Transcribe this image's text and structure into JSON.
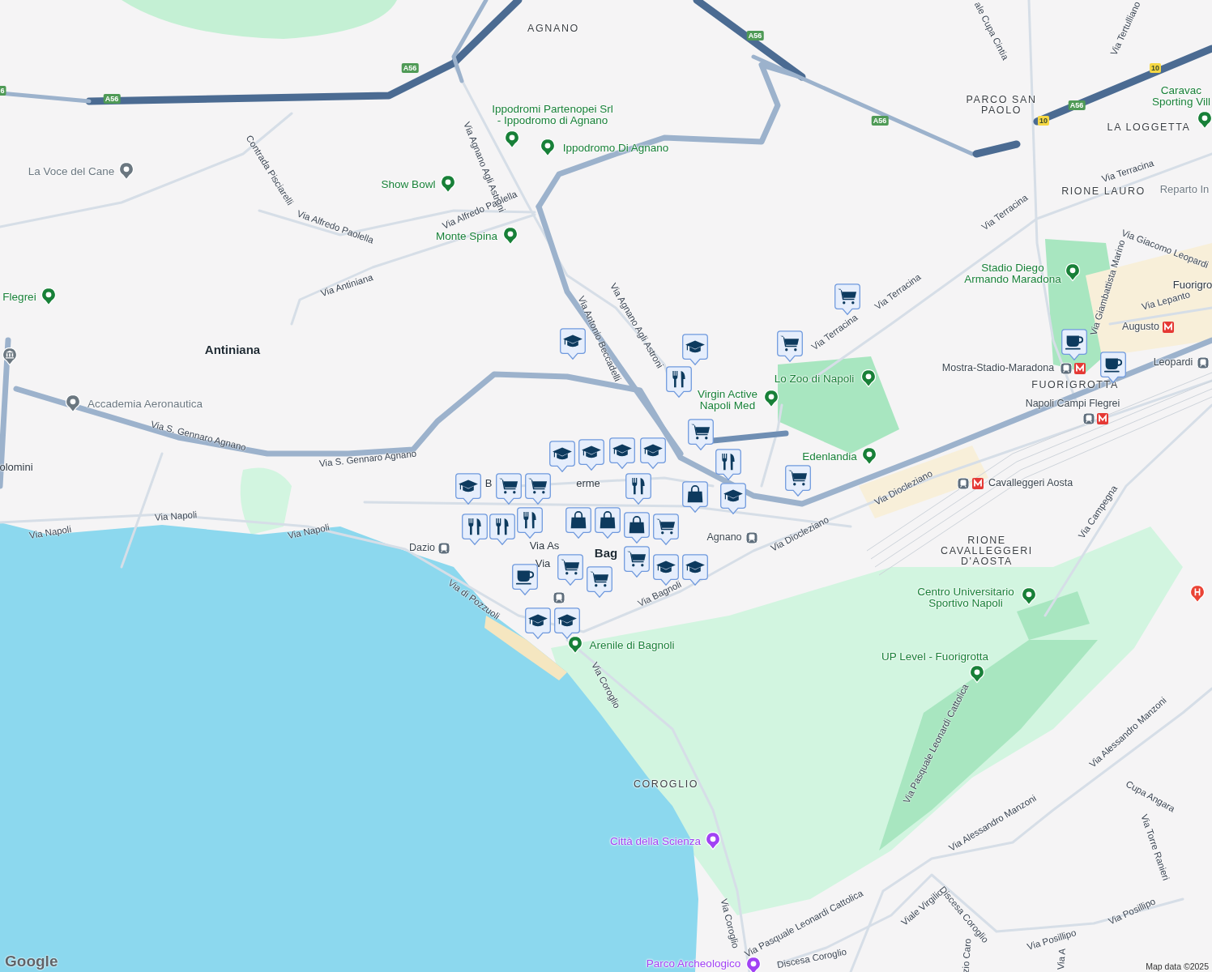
{
  "map": {
    "areas": [
      "AGNANO",
      "PARCO SAN\nPAOLO",
      "LA LOGGETTA",
      "RIONE LAURO",
      "FUORIGROTTA",
      "RIONE\nCAVALLEGGERI\nD'AOSTA",
      "COROGLIO"
    ],
    "labels": [
      {
        "text": "Antiniana",
        "kind": "locality"
      },
      {
        "text": "Fuorigro",
        "kind": "plain"
      },
      {
        "text": "Reparto In",
        "kind": "faded"
      },
      {
        "text": "olomini",
        "kind": "plain"
      },
      {
        "text": "B",
        "kind": "plain"
      },
      {
        "text": "erme",
        "kind": "plain"
      },
      {
        "text": "Via As",
        "kind": "plain"
      },
      {
        "text": "Via",
        "kind": "plain"
      },
      {
        "text": "Bag",
        "kind": "locality"
      }
    ],
    "places": [
      {
        "name": "Ippodromi Partenopei Srl\n- Ippodromo di Agnano",
        "color": "#188038"
      },
      {
        "name": "Ippodromo Di Agnano",
        "color": "#188038"
      },
      {
        "name": "Show Bowl",
        "color": "#188038"
      },
      {
        "name": "Monte Spina",
        "color": "#188038"
      },
      {
        "name": "Flegrei",
        "color": "#188038"
      },
      {
        "name": "Lo Zoo di Napoli",
        "color": "#188038"
      },
      {
        "name": "Virgin Active\nNapoli Med",
        "color": "#188038"
      },
      {
        "name": "Edenlandia",
        "color": "#188038"
      },
      {
        "name": "Stadio Diego\nArmando Maradona",
        "color": "#188038"
      },
      {
        "name": "Caravac\nSporting Vill",
        "color": "#188038"
      },
      {
        "name": "Centro Universitario\nSportivo Napoli",
        "color": "#188038"
      },
      {
        "name": "UP Level - Fuorigrotta",
        "color": "#188038"
      },
      {
        "name": "Arenile di Bagnoli",
        "color": "#188038"
      },
      {
        "name": "Città della Scienza",
        "color": "#a142f4"
      },
      {
        "name": "Parco Archeologico",
        "color": "#a142f4"
      },
      {
        "name": "La Voce del Cane",
        "color": "#6b7780"
      },
      {
        "name": "Accademia Aeronautica",
        "color": "#6b7780"
      }
    ],
    "stations": [
      "Mostra-Stadio-Maradona",
      "Napoli Campi Flegrei",
      "Cavalleggeri Aosta",
      "Agnano",
      "Dazio",
      "Augusto",
      "Leopardi"
    ],
    "streets": [
      "Via Agnano Agli Astroni",
      "Contrada Pisciarelli",
      "Via Alfredo Paolella",
      "Via Alfredo Paolella",
      "Via Antiniana",
      "Via Antonio Beccadelli",
      "Via Agnano Agli Astroni",
      "Via Terracina",
      "Via Terracina",
      "Via Terracina",
      "Via Terracina",
      "Via Giacomo Leopardi",
      "Via Giambattista Marino",
      "Via Lepanto",
      "Via S. Gennaro Agnano",
      "Via S. Gennaro Agnano",
      "Via Napoli",
      "Via Napoli",
      "Via Napoli",
      "Via di Pozzuoli",
      "Via Bagnoli",
      "Via Diocleziano",
      "Via Diocleziano",
      "Via Campegna",
      "Via Coroglio",
      "Via Coroglio",
      "Via Pasquale Leonardi Cattolica",
      "Via Pasquale Leonardi Cattolica",
      "Via Alessandro Manzoni",
      "Via Alessandro Manzoni",
      "Cupa Angara",
      "Via Torre Ranieri",
      "Viale Virgilio",
      "Discesa Coroglio",
      "Discesa Coroglio",
      "Via Posillipo",
      "Via Posillipo",
      "Via Tertulliano",
      "ale Cupa Cintia",
      "zio Caro",
      "Via A"
    ],
    "shields": [
      {
        "text": "6",
        "kind": "motorway"
      },
      {
        "text": "A56",
        "kind": "motorway"
      },
      {
        "text": "A56",
        "kind": "motorway"
      },
      {
        "text": "A56",
        "kind": "motorway"
      },
      {
        "text": "A56",
        "kind": "motorway"
      },
      {
        "text": "A56",
        "kind": "motorway"
      },
      {
        "text": "10",
        "kind": "state"
      },
      {
        "text": "10",
        "kind": "state"
      }
    ],
    "markers": [
      {
        "kind": "school"
      },
      {
        "kind": "school"
      },
      {
        "kind": "grocery"
      },
      {
        "kind": "grocery"
      },
      {
        "kind": "restaurant"
      },
      {
        "kind": "grocery"
      },
      {
        "kind": "restaurant"
      },
      {
        "kind": "school"
      },
      {
        "kind": "grocery"
      },
      {
        "kind": "cafe"
      },
      {
        "kind": "cafe"
      },
      {
        "kind": "school"
      },
      {
        "kind": "school"
      },
      {
        "kind": "school"
      },
      {
        "kind": "school"
      },
      {
        "kind": "grocery"
      },
      {
        "kind": "grocery"
      },
      {
        "kind": "restaurant"
      },
      {
        "kind": "shop"
      },
      {
        "kind": "shop"
      },
      {
        "kind": "shop"
      },
      {
        "kind": "restaurant"
      },
      {
        "kind": "grocery"
      },
      {
        "kind": "grocery"
      },
      {
        "kind": "grocery"
      },
      {
        "kind": "grocery"
      },
      {
        "kind": "cafe"
      },
      {
        "kind": "school"
      },
      {
        "kind": "school"
      },
      {
        "kind": "restaurant"
      },
      {
        "kind": "school"
      },
      {
        "kind": "shop"
      },
      {
        "kind": "restaurant"
      },
      {
        "kind": "school"
      },
      {
        "kind": "school"
      }
    ]
  },
  "attribution": "Map data ©2025",
  "logo": "Google"
}
